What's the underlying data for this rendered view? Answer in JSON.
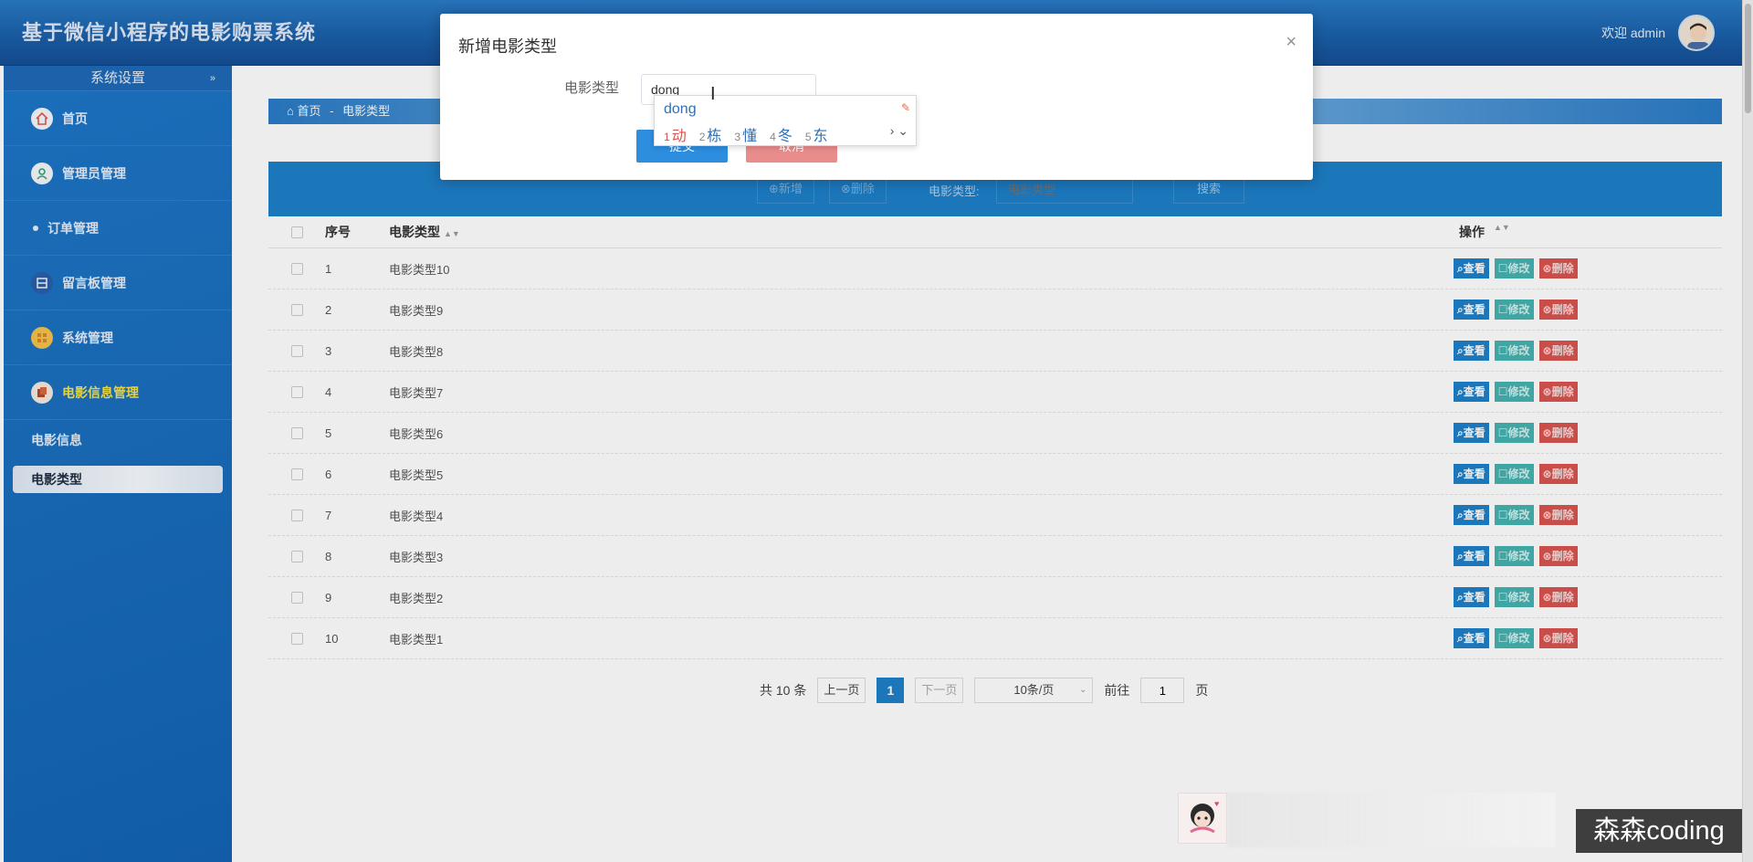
{
  "header": {
    "title": "基于微信小程序的电影购票系统",
    "welcome": "欢迎 admin"
  },
  "sidebar": {
    "section_title": "系统设置",
    "section_arrow": "»",
    "items": [
      {
        "label": "首页",
        "icon": "home-icon"
      },
      {
        "label": "管理员管理",
        "icon": "user-icon"
      },
      {
        "label": "订单管理",
        "icon": "dot-icon"
      },
      {
        "label": "留言板管理",
        "icon": "board-icon"
      },
      {
        "label": "系统管理",
        "icon": "grid-icon"
      },
      {
        "label": "电影信息管理",
        "icon": "film-icon",
        "active": true
      }
    ],
    "sub_items": [
      {
        "label": "电影信息"
      },
      {
        "label": "电影类型",
        "selected": true
      }
    ]
  },
  "breadcrumb": {
    "home": "首页",
    "separator": "-",
    "current": "电影类型"
  },
  "toolbar": {
    "add_label": "⊕新增",
    "delete_label": "⊗删除",
    "filter_label": "电影类型:",
    "filter_placeholder": "电影类型",
    "search_label": "搜索"
  },
  "table": {
    "columns": {
      "no": "序号",
      "name": "电影类型",
      "ops": "操作"
    },
    "rows": [
      {
        "no": "1",
        "name": "电影类型10"
      },
      {
        "no": "2",
        "name": "电影类型9"
      },
      {
        "no": "3",
        "name": "电影类型8"
      },
      {
        "no": "4",
        "name": "电影类型7"
      },
      {
        "no": "5",
        "name": "电影类型6"
      },
      {
        "no": "6",
        "name": "电影类型5"
      },
      {
        "no": "7",
        "name": "电影类型4"
      },
      {
        "no": "8",
        "name": "电影类型3"
      },
      {
        "no": "9",
        "name": "电影类型2"
      },
      {
        "no": "10",
        "name": "电影类型1"
      }
    ],
    "op_labels": {
      "view": "查看",
      "edit": "修改",
      "delete": "删除"
    }
  },
  "pagination": {
    "total": "共 10 条",
    "prev": "上一页",
    "current": "1",
    "next": "下一页",
    "page_size": "10条/页",
    "goto_label": "前往",
    "goto_value": "1",
    "page_unit": "页"
  },
  "modal": {
    "title": "新增电影类型",
    "field_label": "电影类型",
    "field_value": "dong",
    "submit": "提交",
    "cancel": "取消",
    "close": "×"
  },
  "ime": {
    "composition": "dong",
    "candidates": [
      {
        "n": "1",
        "w": "动"
      },
      {
        "n": "2",
        "w": "栋"
      },
      {
        "n": "3",
        "w": "懂"
      },
      {
        "n": "4",
        "w": "冬"
      },
      {
        "n": "5",
        "w": "东"
      }
    ],
    "nav": "› ⌄"
  },
  "watermark": {
    "text": "森森coding"
  },
  "colors": {
    "header_bg": "#1a5ea8",
    "sidebar_bg": "#1a6fbe",
    "active_menu": "#f5e34a",
    "primary": "#1e7fc9",
    "edit": "#45b3b1",
    "delete": "#d9534f"
  }
}
